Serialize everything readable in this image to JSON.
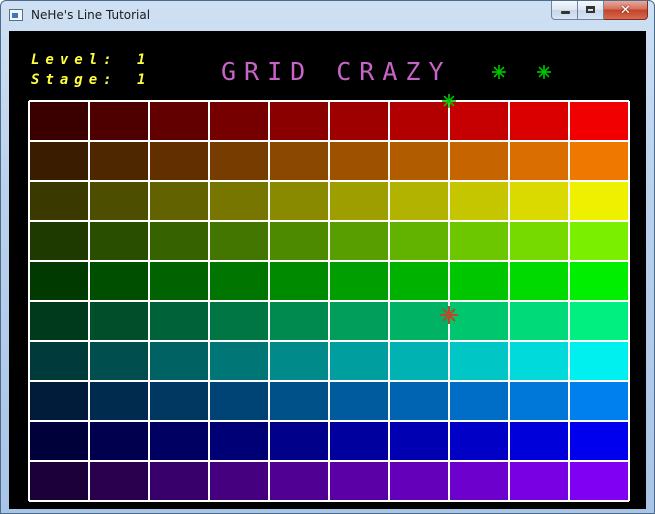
{
  "window": {
    "title": "NeHe's Line Tutorial"
  },
  "hud": {
    "level_label": "Level:",
    "level_value": "1",
    "stage_label": "Stage:",
    "stage_value": "1",
    "game_title": "GRID CRAZY",
    "lives_remaining": 2
  },
  "board": {
    "columns": 10,
    "rows": 10,
    "row_palette": [
      [
        "#3a0000",
        "#4e0000",
        "#620000",
        "#760000",
        "#8a0000",
        "#9e0000",
        "#b20000",
        "#c60000",
        "#da0000",
        "#f00000"
      ],
      [
        "#3a1c00",
        "#4e2600",
        "#623000",
        "#763c00",
        "#8a4800",
        "#9e5200",
        "#b25c00",
        "#c66400",
        "#da6e00",
        "#ef7800"
      ],
      [
        "#3a3a00",
        "#4e4e00",
        "#626200",
        "#767600",
        "#8a8a00",
        "#9e9e00",
        "#b2b200",
        "#c6c600",
        "#dada00",
        "#efef00"
      ],
      [
        "#1e3a00",
        "#2a4e00",
        "#366200",
        "#427600",
        "#4e8a00",
        "#589e00",
        "#62b200",
        "#6cc600",
        "#76da00",
        "#7aef00"
      ],
      [
        "#003a00",
        "#004e00",
        "#006200",
        "#007600",
        "#008a00",
        "#009e00",
        "#00b200",
        "#00c600",
        "#00da00",
        "#00ef00"
      ],
      [
        "#003a1c",
        "#004e2a",
        "#006238",
        "#007644",
        "#008a50",
        "#009e5a",
        "#00b264",
        "#00c66e",
        "#00da78",
        "#00ef80"
      ],
      [
        "#003a3a",
        "#004e4e",
        "#006262",
        "#007676",
        "#008a8a",
        "#009e9e",
        "#00b2b2",
        "#00c6c6",
        "#00dada",
        "#00efef"
      ],
      [
        "#001c3a",
        "#002a4e",
        "#003862",
        "#004476",
        "#00508a",
        "#005a9e",
        "#0064b2",
        "#006ec6",
        "#0078da",
        "#0080ef"
      ],
      [
        "#00003a",
        "#00004e",
        "#000062",
        "#000076",
        "#00008a",
        "#00009e",
        "#0000b2",
        "#0000c6",
        "#0000da",
        "#0000ef"
      ],
      [
        "#1c003a",
        "#2a004e",
        "#38006a",
        "#44007e",
        "#500092",
        "#5a00a6",
        "#6400ba",
        "#6e00ce",
        "#7800e2",
        "#8000f4"
      ]
    ],
    "line_color": "#ffffff"
  },
  "player": {
    "color": "#00c800",
    "col": 7,
    "row": 0
  },
  "enemy": {
    "color": "#b84a2a",
    "col": 7,
    "row": 5
  },
  "colors": {
    "hud_text": "#ffff40",
    "title": "#c864c8",
    "lives": "#00c800"
  }
}
